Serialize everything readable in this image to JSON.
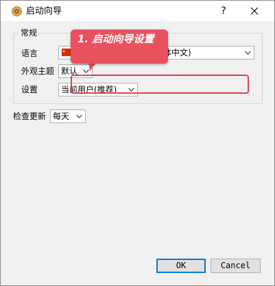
{
  "window": {
    "title": "启动向导",
    "help_glyph": "?",
    "icon": "gear-app-icon"
  },
  "general": {
    "group_title": "常规",
    "language_label": "语言",
    "language_value_suffix": "体中文)",
    "language_flag": "china-flag-icon",
    "theme_label": "外观主题",
    "theme_value": "默认",
    "settings_label": "设置",
    "settings_value": "当前用户(推荐)"
  },
  "update": {
    "label": "检查更新",
    "value": "每天"
  },
  "annotation": {
    "text": "1. 启动向导设置",
    "color": "#e8515e"
  },
  "buttons": {
    "ok": "OK",
    "cancel": "Cancel"
  },
  "colors": {
    "accent": "#0078d7",
    "annotation": "#e03d4c"
  }
}
